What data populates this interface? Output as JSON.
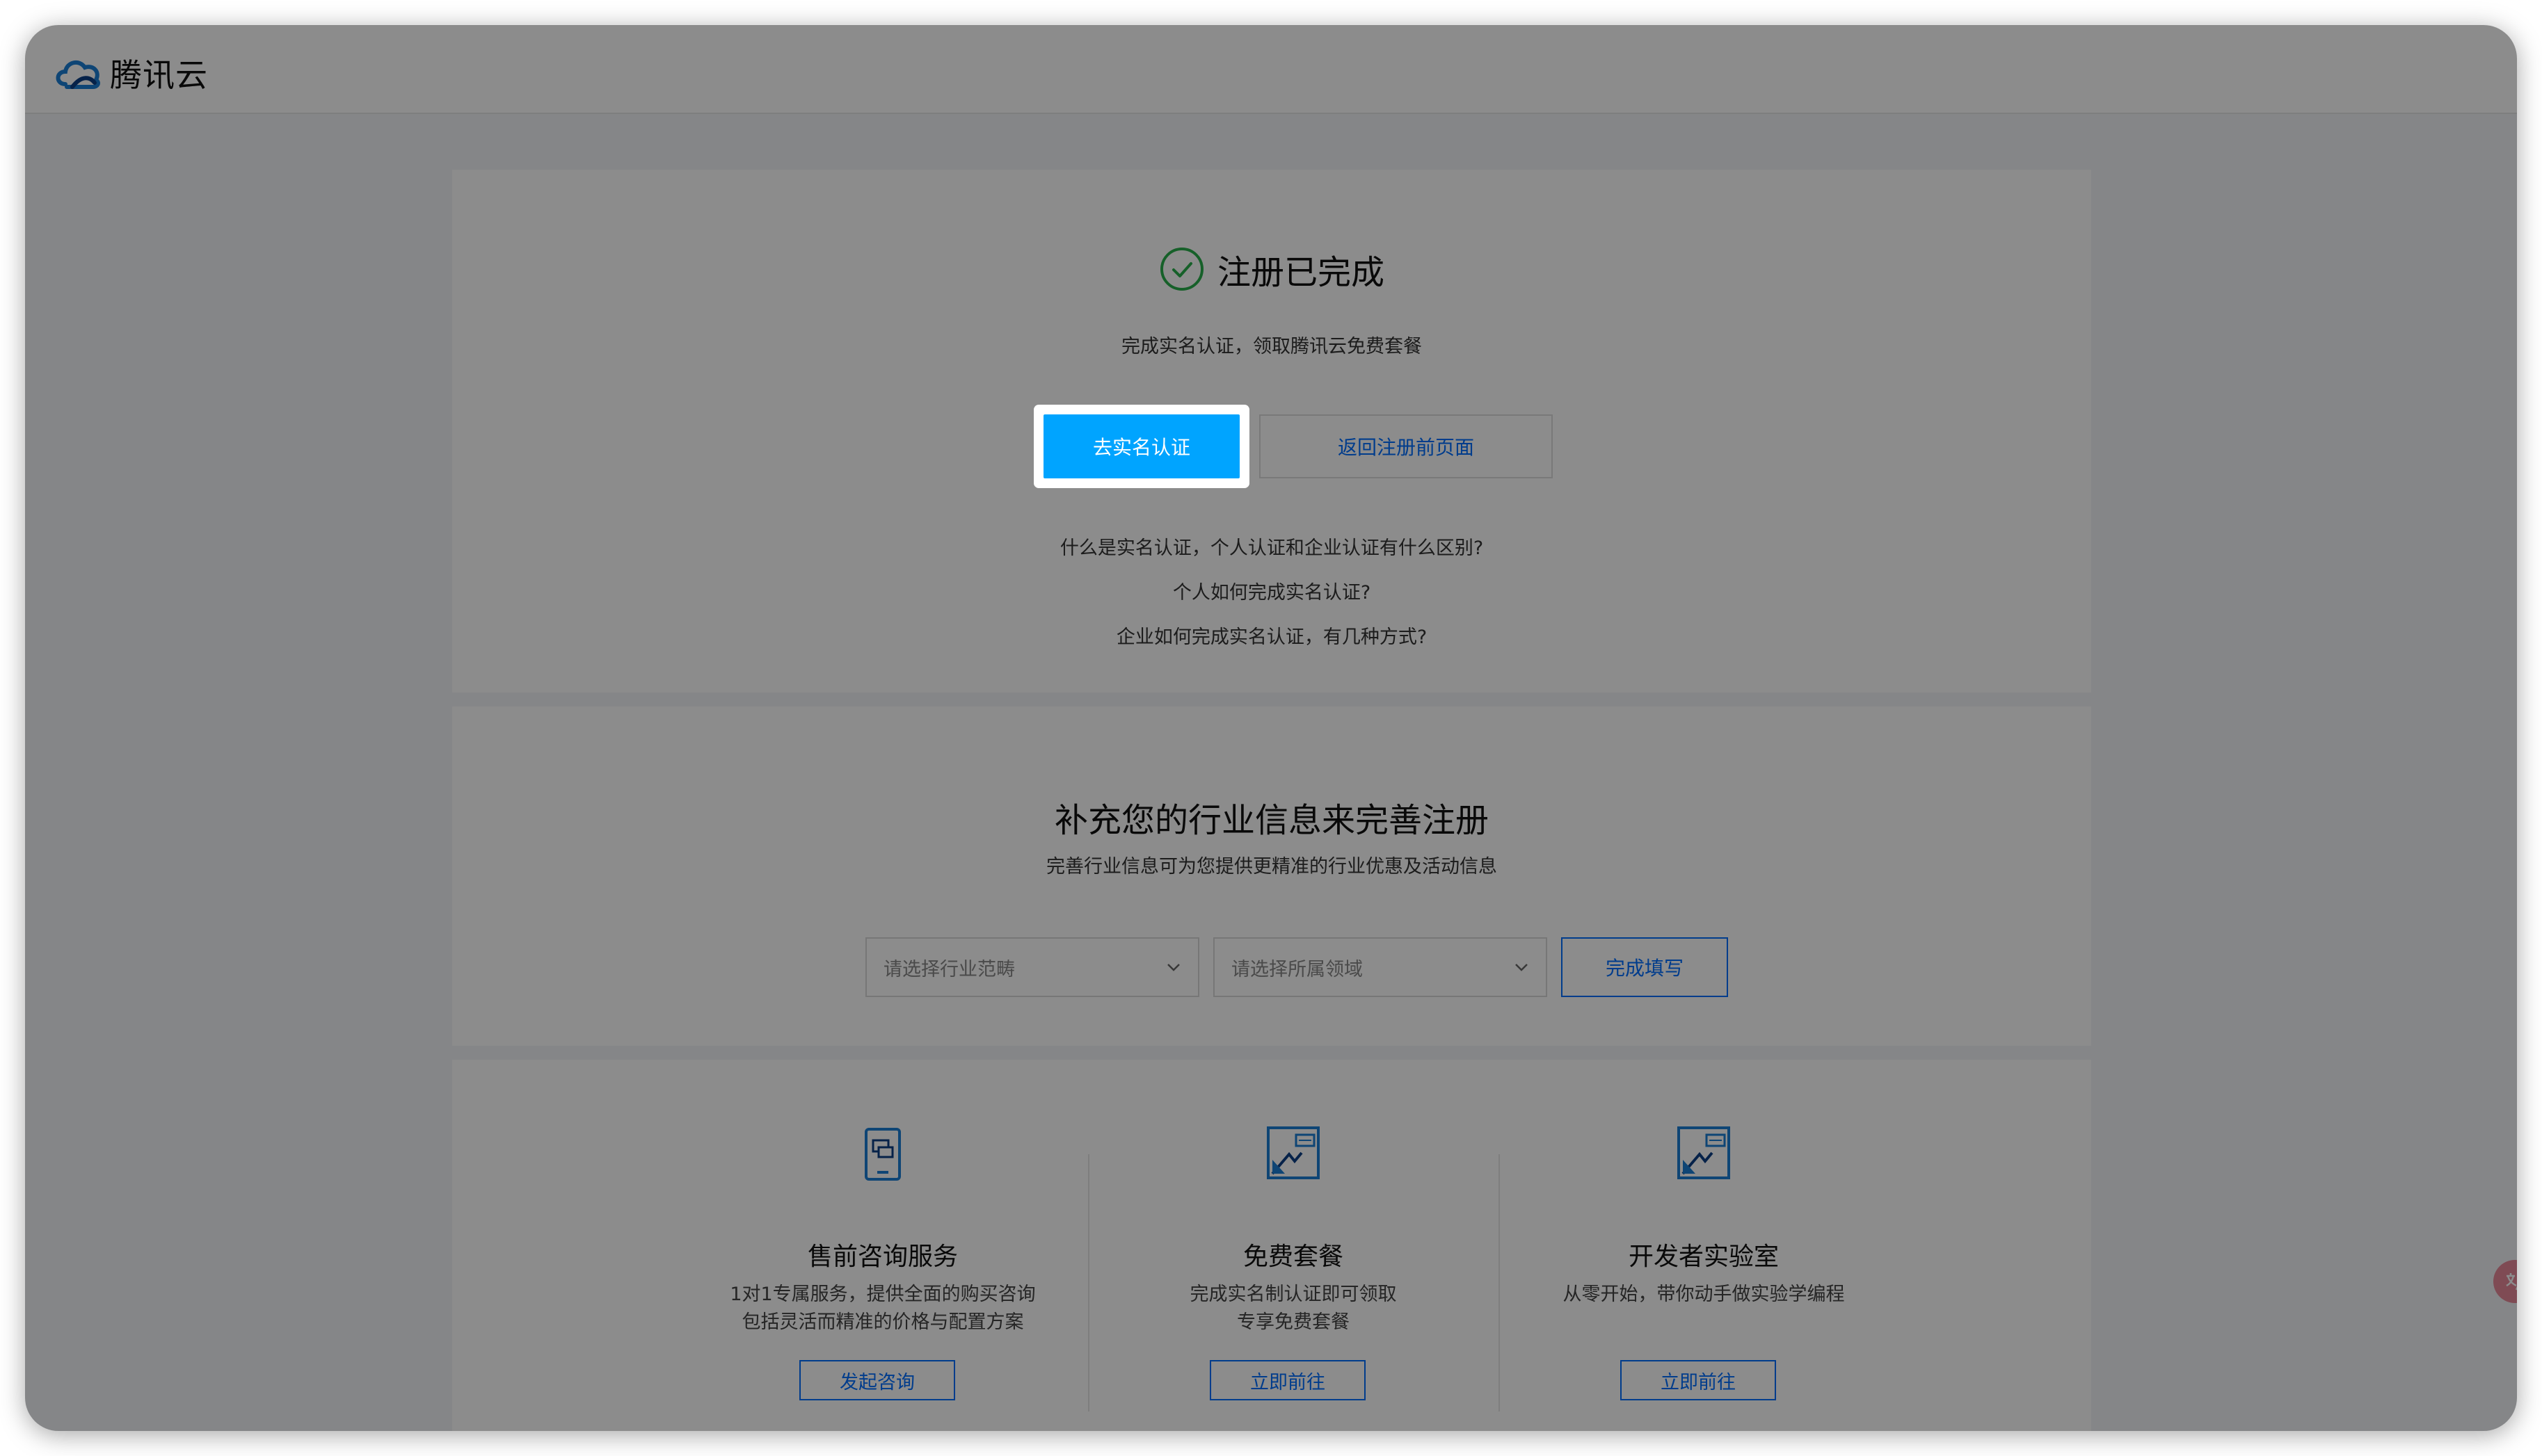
{
  "header": {
    "logo_text": "腾讯云"
  },
  "registration": {
    "title": "注册已完成",
    "promo": "完成实名认证，领取腾讯云免费套餐",
    "primary_button": "去实名认证",
    "secondary_button": "返回注册前页面",
    "faq": [
      "什么是实名认证，个人认证和企业认证有什么区别?",
      "个人如何完成实名认证?",
      "企业如何完成实名认证，有几种方式?"
    ]
  },
  "industry": {
    "title": "补充您的行业信息来完善注册",
    "subtitle": "完善行业信息可为您提供更精准的行业优惠及活动信息",
    "select_category_placeholder": "请选择行业范畴",
    "select_field_placeholder": "请选择所属领域",
    "submit_button": "完成填写"
  },
  "services": [
    {
      "title": "售前咨询服务",
      "desc_line1": "1对1专属服务，提供全面的购买咨询",
      "desc_line2": "包括灵活而精准的价格与配置方案",
      "button": "发起咨询",
      "icon": "chat-phone-icon"
    },
    {
      "title": "免费套餐",
      "desc_line1": "完成实名制认证即可领取",
      "desc_line2": "专享免费套餐",
      "button": "立即前往",
      "icon": "package-icon"
    },
    {
      "title": "开发者实验室",
      "desc_line1": "从零开始，带你动手做实验学编程",
      "desc_line2": "",
      "button": "立即前往",
      "icon": "lab-icon"
    }
  ],
  "floating": {
    "icon": "translate-icon"
  },
  "colors": {
    "primary": "#00a4ff",
    "link": "#006eff",
    "success": "#29b04b",
    "overlay": "rgba(0,0,0,0.45)"
  }
}
